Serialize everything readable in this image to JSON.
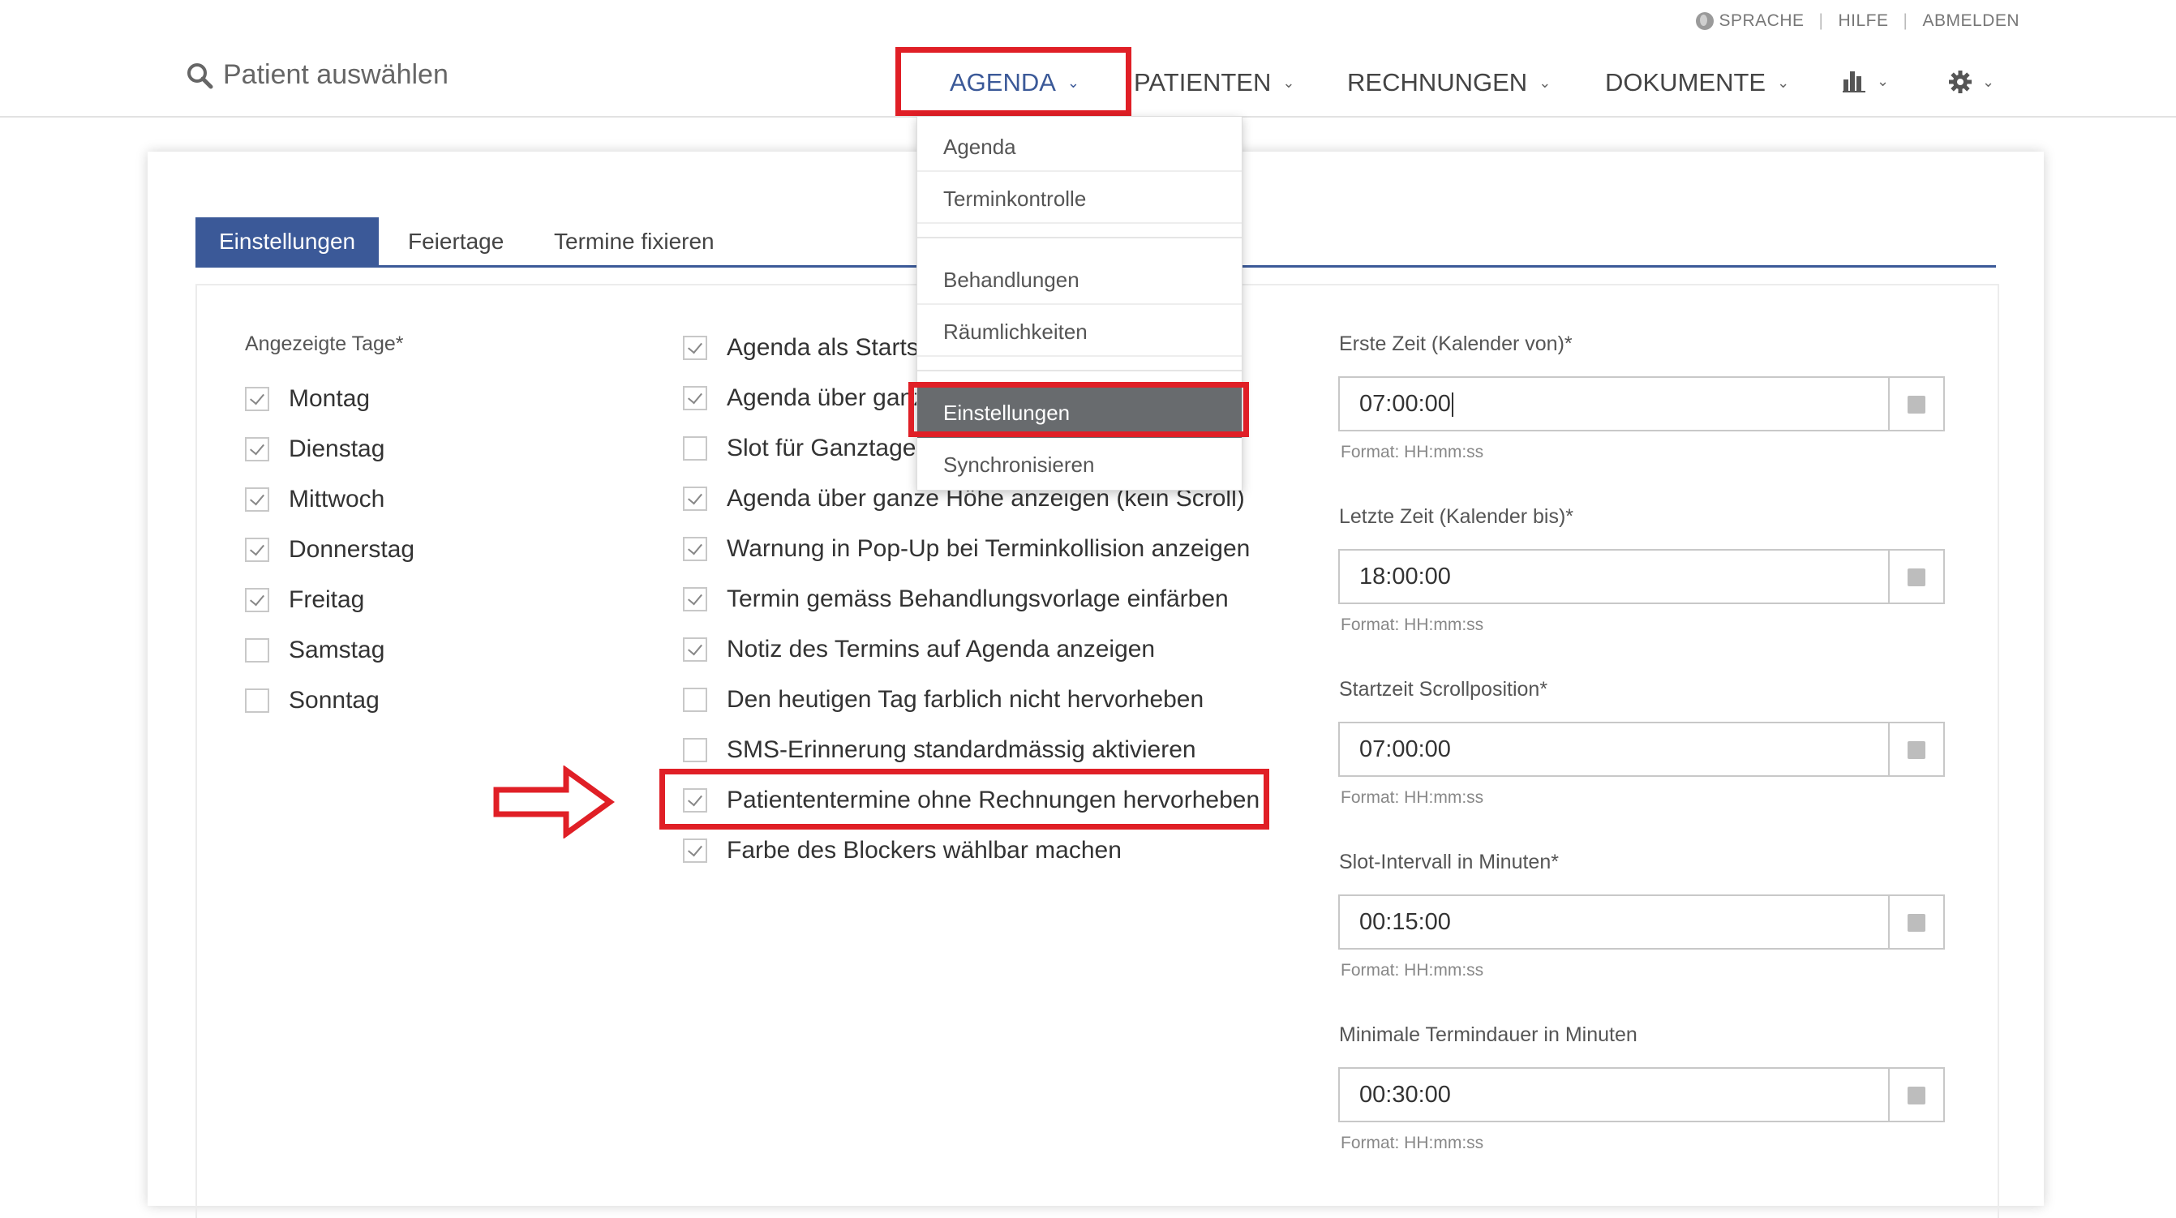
{
  "utility": {
    "language": "SPRACHE",
    "help": "HILFE",
    "logout": "ABMELDEN"
  },
  "search": {
    "placeholder": "Patient auswählen"
  },
  "nav": {
    "agenda": "AGENDA",
    "patienten": "PATIENTEN",
    "rechnungen": "RECHNUNGEN",
    "dokumente": "DOKUMENTE"
  },
  "dropdown": {
    "items": [
      "Agenda",
      "Terminkontrolle",
      "Behandlungen",
      "Räumlichkeiten",
      "Einstellungen",
      "Synchronisieren"
    ],
    "active": "Einstellungen"
  },
  "tabs": [
    "Einstellungen",
    "Feiertage",
    "Termine fixieren"
  ],
  "days": {
    "label": "Angezeigte Tage*",
    "items": [
      {
        "label": "Montag",
        "checked": true
      },
      {
        "label": "Dienstag",
        "checked": true
      },
      {
        "label": "Mittwoch",
        "checked": true
      },
      {
        "label": "Donnerstag",
        "checked": true
      },
      {
        "label": "Freitag",
        "checked": true
      },
      {
        "label": "Samstag",
        "checked": false
      },
      {
        "label": "Sonntag",
        "checked": false
      }
    ]
  },
  "options": [
    {
      "label": "Agenda als Startseite",
      "checked": true
    },
    {
      "label": "Agenda über ganze Breite anzeigen",
      "checked": true
    },
    {
      "label": "Slot für Ganztagestermine",
      "checked": false
    },
    {
      "label": "Agenda über ganze Höhe anzeigen (kein Scroll)",
      "checked": true
    },
    {
      "label": "Warnung in Pop-Up bei Terminkollision anzeigen",
      "checked": true
    },
    {
      "label": "Termin gemäss Behandlungsvorlage einfärben",
      "checked": true
    },
    {
      "label": "Notiz des Termins auf Agenda anzeigen",
      "checked": true
    },
    {
      "label": "Den heutigen Tag farblich nicht hervorheben",
      "checked": false
    },
    {
      "label": "SMS-Erinnerung standardmässig aktivieren",
      "checked": false
    },
    {
      "label": "Patiententermine ohne Rechnungen hervorheben",
      "checked": true
    },
    {
      "label": "Farbe des Blockers wählbar machen",
      "checked": true
    }
  ],
  "fields": [
    {
      "label": "Erste Zeit (Kalender von)*",
      "value": "07:00:00",
      "format": "Format: HH:mm:ss"
    },
    {
      "label": "Letzte Zeit (Kalender bis)*",
      "value": "18:00:00",
      "format": "Format: HH:mm:ss"
    },
    {
      "label": "Startzeit Scrollposition*",
      "value": "07:00:00",
      "format": "Format: HH:mm:ss"
    },
    {
      "label": "Slot-Intervall in Minuten*",
      "value": "00:15:00",
      "format": "Format: HH:mm:ss"
    },
    {
      "label": "Minimale Termindauer in Minuten",
      "value": "00:30:00",
      "format": "Format: HH:mm:ss"
    }
  ],
  "colors": {
    "accent": "#3b5998",
    "highlight": "#e01f26",
    "menu_active": "#686b6e"
  },
  "icons": [
    "globe-icon",
    "search-icon",
    "bar-chart-icon",
    "gear-icon",
    "arrow-right-icon",
    "calendar-icon"
  ]
}
